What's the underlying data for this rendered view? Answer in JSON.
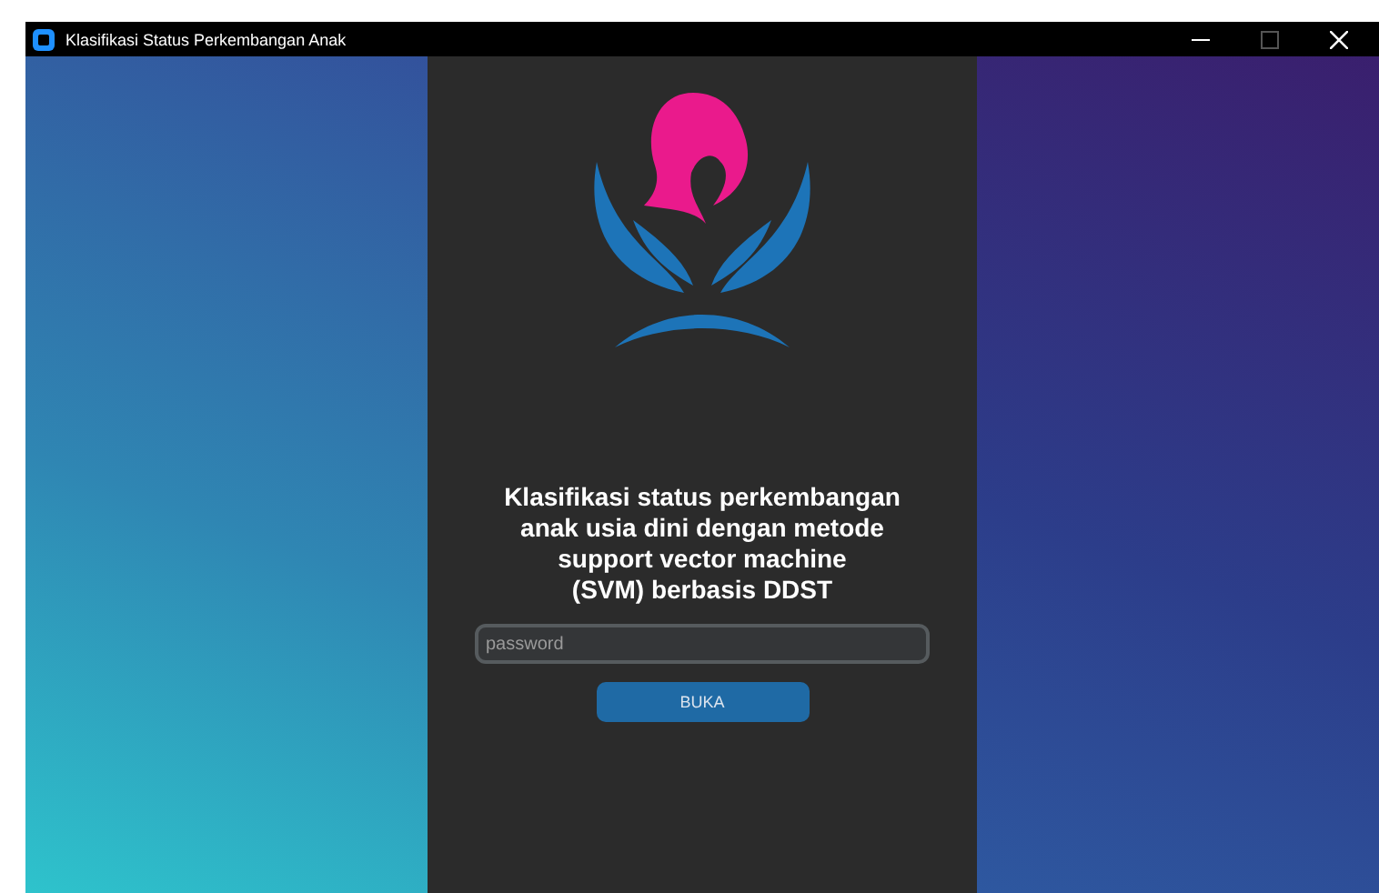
{
  "window": {
    "title": "Klasifikasi Status Perkembangan Anak",
    "maximize_disabled": true
  },
  "heading": "Klasifikasi status perkembangan\nanak usia dini dengan metode\nsupport vector machine\n(SVM) berbasis DDST",
  "password": {
    "placeholder": "password"
  },
  "button": "BUKA"
}
